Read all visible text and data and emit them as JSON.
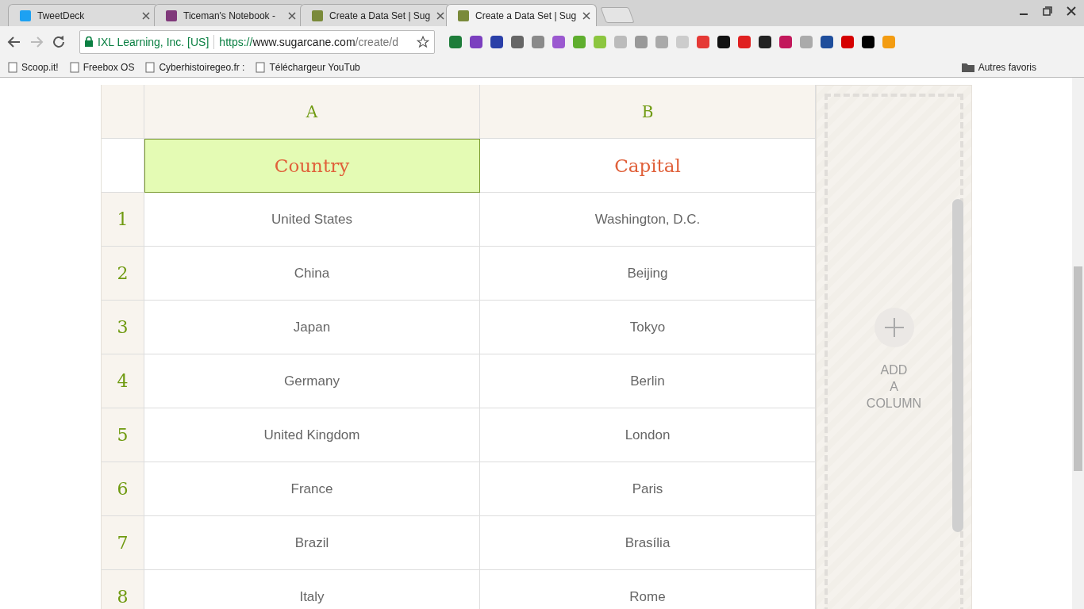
{
  "tabs": [
    {
      "title": "TweetDeck",
      "selected": false,
      "color": "#1da1f2"
    },
    {
      "title": "Ticeman's Notebook -",
      "selected": false,
      "color": "#80397b"
    },
    {
      "title": "Create a Data Set | Sug",
      "selected": false,
      "color": "#7a8a3a"
    },
    {
      "title": "Create a Data Set | Sug",
      "selected": true,
      "color": "#7a8a3a"
    }
  ],
  "address_bar": {
    "site_identity": "IXL Learning, Inc. [US]",
    "scheme": "https://",
    "host": "www.sugarcane.com",
    "path": "/create/d"
  },
  "extensions": [
    {
      "color": "#1e7d3a"
    },
    {
      "color": "#7b3fbf"
    },
    {
      "color": "#2a3fa8"
    },
    {
      "color": "#666666"
    },
    {
      "color": "#8a8a8a"
    },
    {
      "color": "#9b59d0"
    },
    {
      "color": "#5fae2e"
    },
    {
      "color": "#8cc63f"
    },
    {
      "color": "#bbbbbb"
    },
    {
      "color": "#999999"
    },
    {
      "color": "#aaaaaa"
    },
    {
      "color": "#cccccc"
    },
    {
      "color": "#e53935"
    },
    {
      "color": "#111111"
    },
    {
      "color": "#e02020"
    },
    {
      "color": "#222222"
    },
    {
      "color": "#c2185b"
    },
    {
      "color": "#aaaaaa"
    },
    {
      "color": "#1f4e9c"
    },
    {
      "color": "#d50000"
    },
    {
      "color": "#000000"
    },
    {
      "color": "#f39c12"
    }
  ],
  "bookmarks": [
    {
      "label": "Scoop.it!"
    },
    {
      "label": "Freebox OS"
    },
    {
      "label": "Cyberhistoiregeo.fr :"
    },
    {
      "label": "Téléchargeur YouTub"
    }
  ],
  "other_bookmarks": "Autres favoris",
  "table": {
    "columns": [
      {
        "letter": "A",
        "name": "Country",
        "selected": true
      },
      {
        "letter": "B",
        "name": "Capital",
        "selected": false
      }
    ],
    "rows": [
      {
        "number": "1",
        "cells": [
          "United States",
          "Washington, D.C."
        ]
      },
      {
        "number": "2",
        "cells": [
          "China",
          "Beijing"
        ]
      },
      {
        "number": "3",
        "cells": [
          "Japan",
          "Tokyo"
        ]
      },
      {
        "number": "4",
        "cells": [
          "Germany",
          "Berlin"
        ]
      },
      {
        "number": "5",
        "cells": [
          "United Kingdom",
          "London"
        ]
      },
      {
        "number": "6",
        "cells": [
          "France",
          "Paris"
        ]
      },
      {
        "number": "7",
        "cells": [
          "Brazil",
          "Brasília"
        ]
      },
      {
        "number": "8",
        "cells": [
          "Italy",
          "Rome"
        ]
      }
    ]
  },
  "add_column": {
    "label_lines": [
      "ADD",
      "A",
      "COLUMN"
    ]
  }
}
